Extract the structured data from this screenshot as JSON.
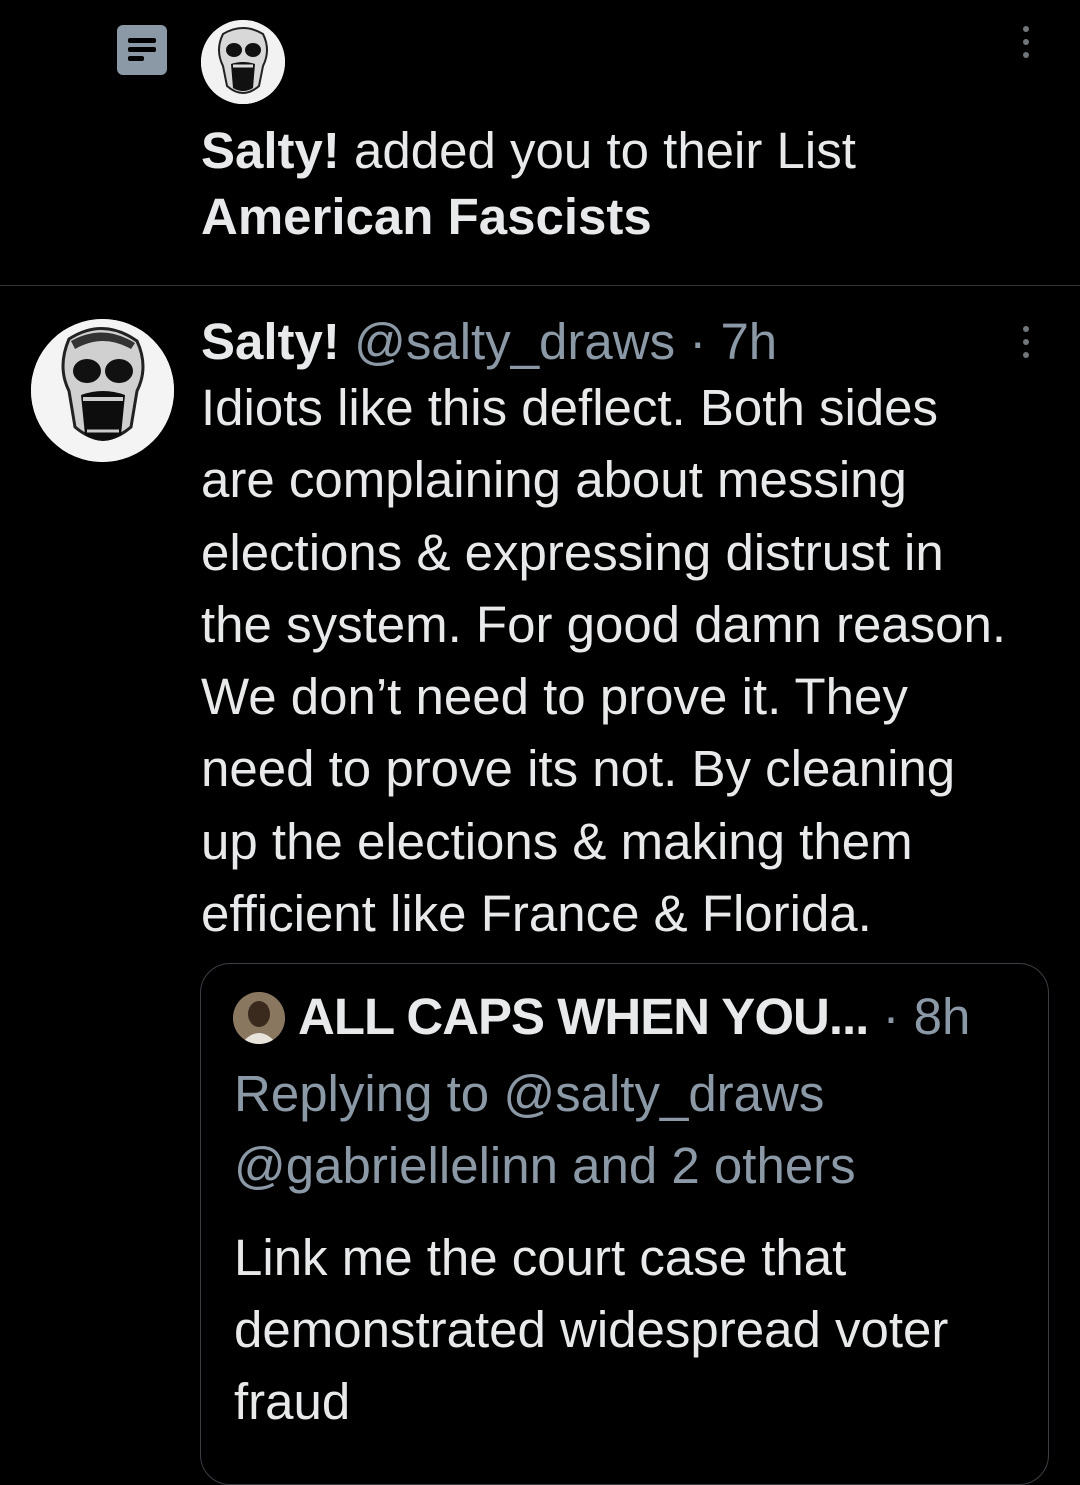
{
  "notification": {
    "icon": "list-icon",
    "avatar": "skull-avatar",
    "actor": "Salty!",
    "action": " added you to their List",
    "list_name": "American Fascists"
  },
  "tweet": {
    "author_name": "Salty!",
    "handle": "@salty_draws",
    "separator": " · ",
    "time": "7h",
    "text": "Idiots like this deflect. Both sides\nare complaining about messing\nelections & expressing distrust in\nthe system. For good damn reason.\nWe don’t need to prove it. They\nneed to prove its not. By cleaning\nup the elections & making them\nefficient like France & Florida."
  },
  "quote": {
    "author_name": "ALL CAPS WHEN YOU...",
    "separator": " · ",
    "time": "8h",
    "replying_to": "Replying to @salty_draws\n@gabriellelinn and 2 others",
    "text": "Link me the court case that\ndemonstrated widespread voter\nfraud"
  },
  "colors": {
    "background": "#000000",
    "text": "#e7e9ea",
    "muted": "#8b98a5",
    "divider": "#2f3336"
  }
}
